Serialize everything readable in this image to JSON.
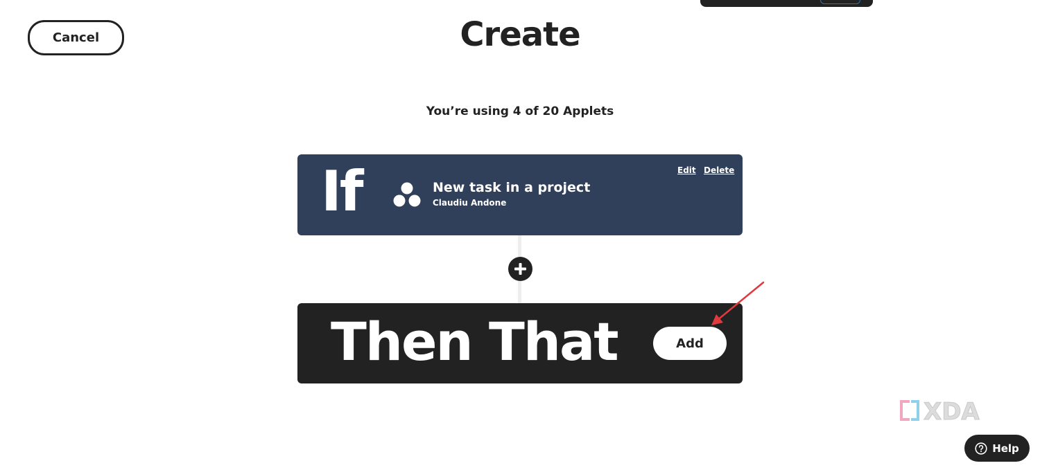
{
  "header": {
    "cancel_label": "Cancel",
    "title": "Create"
  },
  "usage": {
    "text": "You’re using 4 of 20 Applets"
  },
  "if_card": {
    "label": "If",
    "service_icon": "asana-logo-icon",
    "trigger_title": "New task in a project",
    "trigger_subtitle": "Claudiu Andone",
    "edit_label": "Edit",
    "delete_label": "Delete",
    "color": "#31405a"
  },
  "plus": {
    "icon": "plus-icon"
  },
  "then_card": {
    "label": "Then That",
    "add_label": "Add",
    "color": "#222222"
  },
  "annotation": {
    "icon": "red-arrow-icon",
    "color": "#e0393e"
  },
  "watermark": {
    "text": "XDA"
  },
  "help": {
    "label": "Help",
    "icon": "question-circle-icon"
  }
}
